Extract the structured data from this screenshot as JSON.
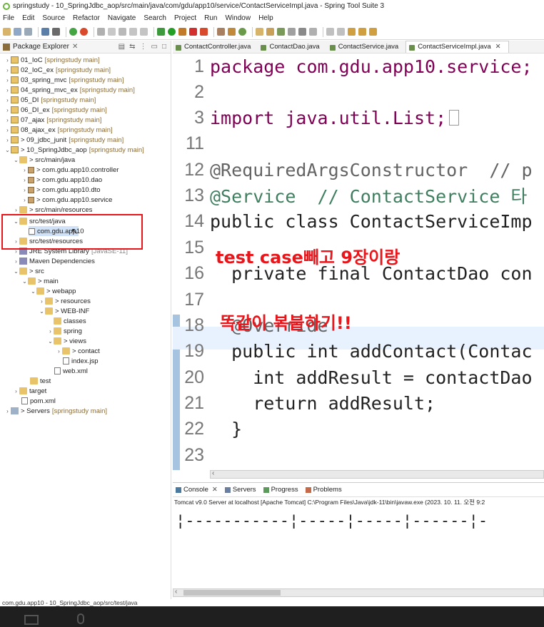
{
  "window": {
    "title": "springstudy - 10_SpringJdbc_aop/src/main/java/com/gdu/app10/service/ContactServiceImpl.java - Spring Tool Suite 3"
  },
  "menu": [
    "File",
    "Edit",
    "Source",
    "Refactor",
    "Navigate",
    "Search",
    "Project",
    "Run",
    "Window",
    "Help"
  ],
  "explorer": {
    "title": "Package Explorer",
    "close": "✕",
    "nodes": [
      {
        "name": "01_IoC",
        "extra": "[springstudy main]"
      },
      {
        "name": "02_IoC_ex",
        "extra": "[springstudy main]"
      },
      {
        "name": "03_spring_mvc",
        "extra": "[springstudy main]"
      },
      {
        "name": "04_spring_mvc_ex",
        "extra": "[springstudy main]"
      },
      {
        "name": "05_DI",
        "extra": "[springstudy main]"
      },
      {
        "name": "06_DI_ex",
        "extra": "[springstudy main]"
      },
      {
        "name": "07_ajax",
        "extra": "[springstudy main]"
      },
      {
        "name": "08_ajax_ex",
        "extra": "[springstudy main]"
      },
      {
        "name": "> 09_jdbc_junit",
        "extra": "[springstudy main]"
      },
      {
        "name": "> 10_SpringJdbc_aop",
        "extra": "[springstudy main]"
      },
      {
        "name": "> src/main/java",
        "extra": ""
      },
      {
        "name": "> com.gdu.app10.controller",
        "extra": ""
      },
      {
        "name": "> com.gdu.app10.dao",
        "extra": ""
      },
      {
        "name": "> com.gdu.app10.dto",
        "extra": ""
      },
      {
        "name": "> com.gdu.app10.service",
        "extra": ""
      },
      {
        "name": "> src/main/resources",
        "extra": ""
      },
      {
        "name": "src/test/java",
        "extra": ""
      },
      {
        "name": "com.gdu.app10",
        "extra": ""
      },
      {
        "name": "src/test/resources",
        "extra": ""
      },
      {
        "name": "JRE System Library",
        "extra": "[JavaSE-11]"
      },
      {
        "name": "Maven Dependencies",
        "extra": ""
      },
      {
        "name": "> src",
        "extra": ""
      },
      {
        "name": "> main",
        "extra": ""
      },
      {
        "name": "> webapp",
        "extra": ""
      },
      {
        "name": "> resources",
        "extra": ""
      },
      {
        "name": "> WEB-INF",
        "extra": ""
      },
      {
        "name": "classes",
        "extra": ""
      },
      {
        "name": "spring",
        "extra": ""
      },
      {
        "name": "> views",
        "extra": ""
      },
      {
        "name": "> contact",
        "extra": ""
      },
      {
        "name": "index.jsp",
        "extra": ""
      },
      {
        "name": "web.xml",
        "extra": ""
      },
      {
        "name": "test",
        "extra": ""
      },
      {
        "name": "target",
        "extra": ""
      },
      {
        "name": "pom.xml",
        "extra": ""
      },
      {
        "name": "> Servers",
        "extra": "[springstudy main]"
      }
    ]
  },
  "editor": {
    "tabs": [
      "ContactController.java",
      "ContactDao.java",
      "ContactService.java",
      "ContactServiceImpl.java"
    ],
    "active_close": "✕",
    "lines": [
      {
        "n": "1",
        "t": "package com.gdu.app10.service;"
      },
      {
        "n": "2",
        "t": ""
      },
      {
        "n": "3",
        "t": "import java.util.List;"
      },
      {
        "n": "11",
        "t": ""
      },
      {
        "n": "12",
        "t": "@RequiredArgsConstructor  // p"
      },
      {
        "n": "13",
        "t": "@Service  // ContactService 타"
      },
      {
        "n": "14",
        "t": "public class ContactServiceImp"
      },
      {
        "n": "15",
        "t": ""
      },
      {
        "n": "16",
        "t": "  private final ContactDao con"
      },
      {
        "n": "17",
        "t": ""
      },
      {
        "n": "18",
        "t": "  @Override"
      },
      {
        "n": "19",
        "t": "  public int addContact(Contac"
      },
      {
        "n": "20",
        "t": "    int addResult = contactDao"
      },
      {
        "n": "21",
        "t": "    return addResult;"
      },
      {
        "n": "22",
        "t": "  }"
      },
      {
        "n": "23",
        "t": ""
      }
    ],
    "annotations": [
      "test case빼고 9장이랑",
      "똑같이 복붙하기!!"
    ]
  },
  "console": {
    "tabs": [
      "Console",
      "Servers",
      "Progress",
      "Problems"
    ],
    "info": "Tomcat v9.0 Server at localhost [Apache Tomcat] C:\\Program Files\\Java\\jdk-11\\bin\\javaw.exe  (2023. 10. 11. 오전 9:2",
    "output": "¦-----------¦-----¦-----¦------¦-"
  },
  "status": {
    "text": "com.gdu.app10 - 10_SpringJdbc_aop/src/test/java"
  },
  "colors": {
    "annotation": "#e8161b",
    "keyword": "#7f0055",
    "selection_box": "#e8161b"
  }
}
